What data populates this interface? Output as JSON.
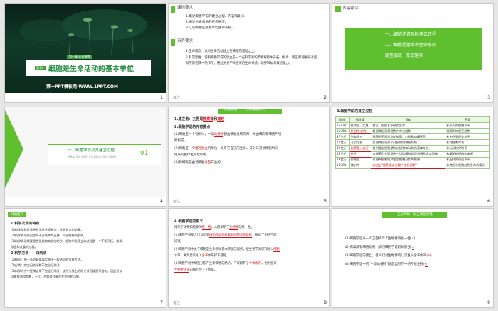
{
  "colors": {
    "accent": "#5fbf2f",
    "dark": "#0c2a20",
    "red": "#d0141c"
  },
  "s1": {
    "tag": "第一章 走近细胞",
    "section": "第1节",
    "title": "细胞是生命活动的基本单位",
    "footer": "第一PPT模板网-WWW.1PPT.COM",
    "num": "1"
  },
  "s2": {
    "h1": "课标要求",
    "goals": [
      "1.概述细胞学说的建立过程、内容和意义。",
      "2.阐述生命系统的结构层次。",
      "3.认同细胞是最基本的生命系统。"
    ],
    "h2": "素养要求",
    "skill1a": "1.生命观念：认同生命活动建立在细胞的基础之上。",
    "skill2a": "2.科学思维：说明细胞学说的建立是一个在科学家的不断探索中开拓、继承、修正和发展的过程。",
    "skill2b": "科学家在其中的作用；通过分析不同层次的生命系统，培养归纳与概括能力。",
    "num": "2"
  },
  "s3": {
    "label": "内容索引",
    "items": [
      "一、细胞学说及其建立过程",
      "二、细胞是基本的生命系统",
      "随堂演练　知识落实"
    ],
    "num": "3"
  },
  "s4": {
    "title": "一、细胞学说及其建立过程",
    "sub": "XI BAO XUE SHUO JI QI JIAN LI GUO CHENG",
    "index": "01",
    "num": "4"
  },
  "s5": {
    "tab1": "基础梳理",
    "tab2": "夯实基础知识",
    "l1a": "1.建立者：主要是",
    "l1b": "施莱登",
    "l1c": "和",
    "l1d": "施旺",
    "l2": "2.细胞学说的内容要点",
    "l3a": "(1)细胞是一个有机体，一切",
    "l3b": "动植物",
    "l3c": "都由细胞发育而来，并由细胞和细胞产物",
    "l3d": "所构成。",
    "l4a": "(2)细胞是一个",
    "l4b": "相对独立",
    "l4c": "的单位，既有它自己的生命，又对与其他细胞共同",
    "l4d": "组成的整体生命起作用。",
    "l5a": "(3)新细胞是由老细胞",
    "l5b": "分裂",
    "l5c": "产生的。",
    "num": "5"
  },
  "s6": {
    "title": "3.细胞学说的建立过程",
    "headers": [
      "时间",
      "科学家",
      "贡献",
      "不足"
    ],
    "rows": [
      [
        "1543年",
        "维萨里，比夏",
        "器官、组织水平研究生命",
        "未深入到细胞水平"
      ],
      [
        "1665年",
        "罗伯特·胡克",
        "用显微镜观察细胞并命名细胞",
        "观察到的是死细胞"
      ],
      [
        "17世纪",
        "列文虎克",
        "观察到不同形态的细菌、红细胞和精子等",
        "未上升到理论水平"
      ],
      [
        "17世纪",
        "马尔比基",
        "用显微镜观察了动植物的微细结构",
        "未对细胞命名"
      ],
      [
        "19世纪",
        "施莱登，施旺",
        "首先提出细胞是构成植物和动物的基本单位",
        "未与动物界联系"
      ],
      [
        "19世纪",
        "施旺",
        "与施莱登共同提出一切动植物都是由细胞发育而来",
        "未阐明新细胞的来源"
      ],
      [
        "19世纪",
        "耐格里",
        "发现新细胞的产生是细胞分裂的结果",
        "未上升到理论水平"
      ],
      [
        "1858年",
        "魏尔肖",
        "总结出“细胞通过分裂产生新细胞”",
        "未考虑非细胞结构生命的情况"
      ]
    ],
    "num": "6"
  },
  "s7": {
    "badge": "归纳提升",
    "h1": "1.科学发现的特点",
    "p1": "(1)科学发现是多种科学家共同参与、共同努力的结果。",
    "p2": "(2)科学发现的过程离不开技术的支持，如显微镜的发明。",
    "p3": "(3)科学发现需要理性思维和实验的结合，细胞学说建立的过程是一个不断开拓、继承、",
    "p4": "修正和发展的过程。",
    "h2": "2.科学方法——归纳法",
    "p5": "(1)概念：由一系列具体事实推出一般结论的思维方法。",
    "p6": "(2)分类：完全归纳法和不完全归纳法。",
    "p7": "(3)科学研究中经常运用不完全归纳法，该方法推出的结论很可能是可信的，因此可以",
    "p8": "用来预测和判断，不过，也需要注意存在例外的可能。",
    "num": "7"
  },
  "s8": {
    "h": "4.细胞学说的意义",
    "l1a": "揭示了动物和植物的",
    "l1b": "统一性",
    "l1c": "，从而阐明了",
    "l1d": "生物界",
    "l1e": "的统一性。",
    "l2": "(1)细胞学说使人们认识到",
    "l2b": "植物和动物有着共同的结构基础",
    "l2c": "，推进了生物学的",
    "l2d": "研究。",
    "l3a": "(2)细胞学说中关于细胞是生命活动基本单位的观点，使生物学的研究进入",
    "l3b": "细胞",
    "l3c": "水平，并为后来进入",
    "l3d": "分子",
    "l3e": "水平打下基础。",
    "l4a": "(3)细胞学说中细胞分裂产生新细胞的结论，不仅解释了",
    "l4b": "个体发育",
    "l4c": "，也为后来",
    "l4d": "生物进化论",
    "l4e": "的确立埋下了伏笔。",
    "num": "8"
  },
  "s9": {
    "banner": "正误判断　矫正易混易错",
    "items": [
      {
        "text": "(1)细胞学说从一个方面揭示了生物界的统一性(",
        "mark": "√",
        "end": ")"
      },
      {
        "text": "(2)病毒没有细胞结构，说明细胞学说有局限性(",
        "mark": "×",
        "end": ")"
      },
      {
        "text": "(3)细胞学说的建立，使人们对生物体的认识进入分子水平(",
        "mark": "×",
        "end": ")"
      },
      {
        "text": "(4)细胞学说中的“一切动植物”就是自然界中的所有生物(",
        "mark": "×",
        "end": ")"
      }
    ],
    "num": "9"
  },
  "notes": {
    "n2": "备注",
    "n5": "备注",
    "n8": "备注"
  }
}
